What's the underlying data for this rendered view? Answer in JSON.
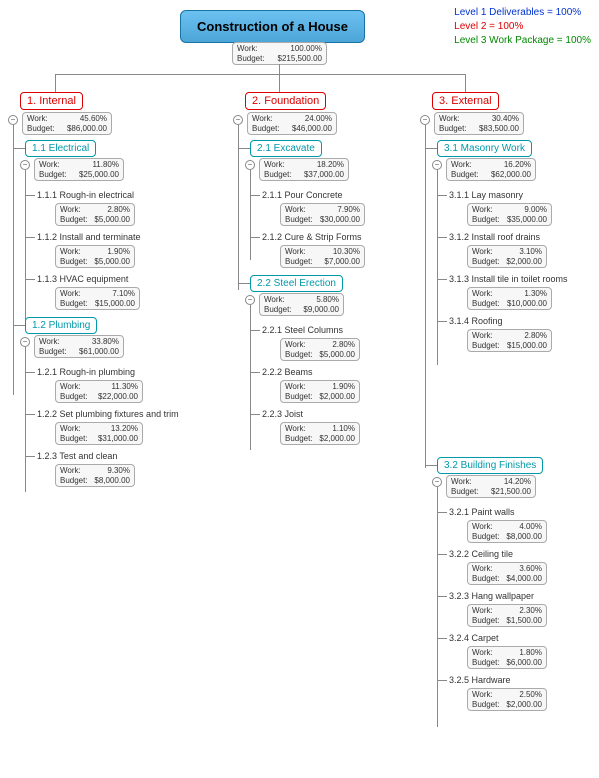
{
  "title": "Construction of a House",
  "legend": {
    "l1": "Level 1 Deliverables = 100%",
    "l2": "Level 2 = 100%",
    "l3": "Level 3 Work Package = 100%"
  },
  "root": {
    "work": "100.00%",
    "budget": "$215,500.00",
    "wlabel": "Work:",
    "blabel": "Budget:"
  },
  "c1": {
    "label": "1. Internal",
    "work": "45.60%",
    "budget": "$86,000.00",
    "s1": {
      "label": "1.1 Electrical",
      "work": "11.80%",
      "budget": "$25,000.00",
      "t1": {
        "label": "1.1.1 Rough-in electrical",
        "work": "2.80%",
        "budget": "$5,000.00"
      },
      "t2": {
        "label": "1.1.2 Install and terminate",
        "work": "1.90%",
        "budget": "$5,000.00"
      },
      "t3": {
        "label": "1.1.3  HVAC equipment",
        "work": "7.10%",
        "budget": "$15,000.00"
      }
    },
    "s2": {
      "label": "1.2 Plumbing",
      "work": "33.80%",
      "budget": "$61,000.00",
      "t1": {
        "label": "1.2.1 Rough-in plumbing",
        "work": "11.30%",
        "budget": "$22,000.00"
      },
      "t2": {
        "label": "1.2.2  Set plumbing fixtures and trim",
        "work": "13.20%",
        "budget": "$31,000.00"
      },
      "t3": {
        "label": "1.2.3 Test and clean",
        "work": "9.30%",
        "budget": "$8,000.00"
      }
    }
  },
  "c2": {
    "label": "2. Foundation",
    "work": "24.00%",
    "budget": "$46,000.00",
    "s1": {
      "label": "2.1 Excavate",
      "work": "18.20%",
      "budget": "$37,000.00",
      "t1": {
        "label": "2.1.1  Pour Concrete",
        "work": "7.90%",
        "budget": "$30,000.00"
      },
      "t2": {
        "label": "2.1.2  Cure & Strip Forms",
        "work": "10.30%",
        "budget": "$7,000.00"
      }
    },
    "s2": {
      "label": "2.2 Steel Erection",
      "work": "5.80%",
      "budget": "$9,000.00",
      "t1": {
        "label": "2.2.1  Steel Columns",
        "work": "2.80%",
        "budget": "$5,000.00"
      },
      "t2": {
        "label": "2.2.2  Beams",
        "work": "1.90%",
        "budget": "$2,000.00"
      },
      "t3": {
        "label": "2.2.3 Joist",
        "work": "1.10%",
        "budget": "$2,000.00"
      }
    }
  },
  "c3": {
    "label": "3. External",
    "work": "30.40%",
    "budget": "$83,500.00",
    "s1": {
      "label": "3.1 Masonry Work",
      "work": "16.20%",
      "budget": "$62,000.00",
      "t1": {
        "label": "3.1.1  Lay masonry",
        "work": "9.00%",
        "budget": "$35,000.00"
      },
      "t2": {
        "label": "3.1.2  Install roof drains",
        "work": "3.10%",
        "budget": "$2,000.00"
      },
      "t3": {
        "label": "3.1.3 Install tile in toilet rooms",
        "work": "1.30%",
        "budget": "$10,000.00"
      },
      "t4": {
        "label": "3.1.4 Roofing",
        "work": "2.80%",
        "budget": "$15,000.00"
      }
    },
    "s2": {
      "label": "3.2  Building Finishes",
      "work": "14.20%",
      "budget": "$21,500.00",
      "t1": {
        "label": "3.2.1  Paint walls",
        "work": "4.00%",
        "budget": "$8,000.00"
      },
      "t2": {
        "label": "3.2.2  Ceiling tile",
        "work": "3.60%",
        "budget": "$4,000.00"
      },
      "t3": {
        "label": "3.2.3  Hang wallpaper",
        "work": "2.30%",
        "budget": "$1,500.00"
      },
      "t4": {
        "label": "3.2.4  Carpet",
        "work": "1.80%",
        "budget": "$6,000.00"
      },
      "t5": {
        "label": "3.2.5 Hardware",
        "work": "2.50%",
        "budget": "$2,000.00"
      }
    }
  },
  "chart_data": {
    "type": "tree",
    "title": "Construction of a House",
    "root": {
      "name": "Construction of a House",
      "work_pct": 100.0,
      "budget": 215500
    },
    "children": [
      {
        "id": "1",
        "name": "Internal",
        "work_pct": 45.6,
        "budget": 86000,
        "children": [
          {
            "id": "1.1",
            "name": "Electrical",
            "work_pct": 11.8,
            "budget": 25000,
            "children": [
              {
                "id": "1.1.1",
                "name": "Rough-in electrical",
                "work_pct": 2.8,
                "budget": 5000
              },
              {
                "id": "1.1.2",
                "name": "Install and terminate",
                "work_pct": 1.9,
                "budget": 5000
              },
              {
                "id": "1.1.3",
                "name": "HVAC equipment",
                "work_pct": 7.1,
                "budget": 15000
              }
            ]
          },
          {
            "id": "1.2",
            "name": "Plumbing",
            "work_pct": 33.8,
            "budget": 61000,
            "children": [
              {
                "id": "1.2.1",
                "name": "Rough-in plumbing",
                "work_pct": 11.3,
                "budget": 22000
              },
              {
                "id": "1.2.2",
                "name": "Set plumbing fixtures and trim",
                "work_pct": 13.2,
                "budget": 31000
              },
              {
                "id": "1.2.3",
                "name": "Test and clean",
                "work_pct": 9.3,
                "budget": 8000
              }
            ]
          }
        ]
      },
      {
        "id": "2",
        "name": "Foundation",
        "work_pct": 24.0,
        "budget": 46000,
        "children": [
          {
            "id": "2.1",
            "name": "Excavate",
            "work_pct": 18.2,
            "budget": 37000,
            "children": [
              {
                "id": "2.1.1",
                "name": "Pour Concrete",
                "work_pct": 7.9,
                "budget": 30000
              },
              {
                "id": "2.1.2",
                "name": "Cure & Strip Forms",
                "work_pct": 10.3,
                "budget": 7000
              }
            ]
          },
          {
            "id": "2.2",
            "name": "Steel Erection",
            "work_pct": 5.8,
            "budget": 9000,
            "children": [
              {
                "id": "2.2.1",
                "name": "Steel Columns",
                "work_pct": 2.8,
                "budget": 5000
              },
              {
                "id": "2.2.2",
                "name": "Beams",
                "work_pct": 1.9,
                "budget": 2000
              },
              {
                "id": "2.2.3",
                "name": "Joist",
                "work_pct": 1.1,
                "budget": 2000
              }
            ]
          }
        ]
      },
      {
        "id": "3",
        "name": "External",
        "work_pct": 30.4,
        "budget": 83500,
        "children": [
          {
            "id": "3.1",
            "name": "Masonry Work",
            "work_pct": 16.2,
            "budget": 62000,
            "children": [
              {
                "id": "3.1.1",
                "name": "Lay masonry",
                "work_pct": 9.0,
                "budget": 35000
              },
              {
                "id": "3.1.2",
                "name": "Install roof drains",
                "work_pct": 3.1,
                "budget": 2000
              },
              {
                "id": "3.1.3",
                "name": "Install tile in toilet rooms",
                "work_pct": 1.3,
                "budget": 10000
              },
              {
                "id": "3.1.4",
                "name": "Roofing",
                "work_pct": 2.8,
                "budget": 15000
              }
            ]
          },
          {
            "id": "3.2",
            "name": "Building Finishes",
            "work_pct": 14.2,
            "budget": 21500,
            "children": [
              {
                "id": "3.2.1",
                "name": "Paint walls",
                "work_pct": 4.0,
                "budget": 8000
              },
              {
                "id": "3.2.2",
                "name": "Ceiling tile",
                "work_pct": 3.6,
                "budget": 4000
              },
              {
                "id": "3.2.3",
                "name": "Hang wallpaper",
                "work_pct": 2.3,
                "budget": 1500
              },
              {
                "id": "3.2.4",
                "name": "Carpet",
                "work_pct": 1.8,
                "budget": 6000
              },
              {
                "id": "3.2.5",
                "name": "Hardware",
                "work_pct": 2.5,
                "budget": 2000
              }
            ]
          }
        ]
      }
    ]
  }
}
